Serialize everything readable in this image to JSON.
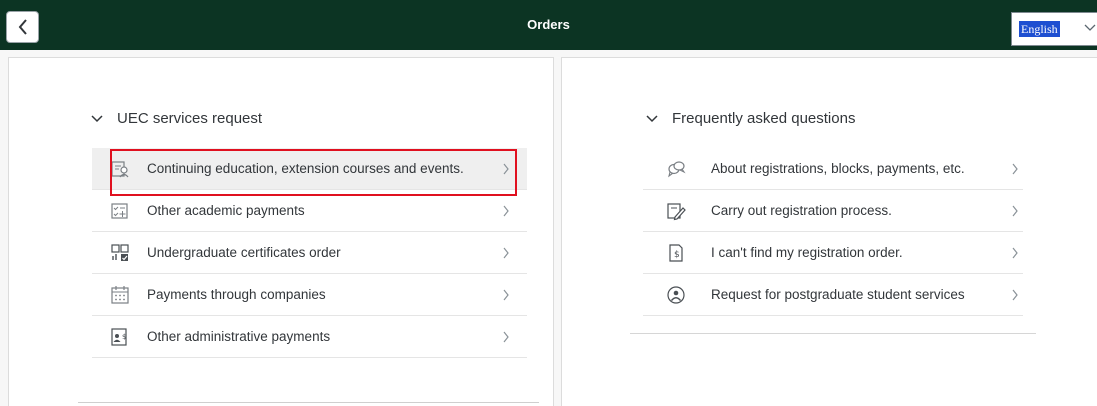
{
  "header": {
    "title": "Orders",
    "back_icon": "chevron-left-icon",
    "language": {
      "selected": "English",
      "icon": "chevron-down-icon"
    }
  },
  "services": {
    "title": "UEC services request",
    "items": [
      {
        "label": "Continuing education, extension courses and events.",
        "icon": "education-icon"
      },
      {
        "label": "Other academic payments",
        "icon": "payments-list-icon"
      },
      {
        "label": "Undergraduate certificates order",
        "icon": "certificate-icon"
      },
      {
        "label": "Payments through companies",
        "icon": "calendar-icon"
      },
      {
        "label": "Other administrative payments",
        "icon": "admin-payment-icon"
      }
    ]
  },
  "faq": {
    "title": "Frequently asked questions",
    "items": [
      {
        "label": "About registrations, blocks, payments, etc.",
        "icon": "discussion-icon"
      },
      {
        "label": "Carry out registration process.",
        "icon": "edit-document-icon"
      },
      {
        "label": "I can't find my registration order.",
        "icon": "payment-document-icon"
      },
      {
        "label": "Request for postgraduate student services",
        "icon": "support-icon"
      }
    ]
  },
  "colors": {
    "header_bg": "#0c3423",
    "highlight": "#e0101f",
    "language_highlight": "#1e4fd1"
  }
}
